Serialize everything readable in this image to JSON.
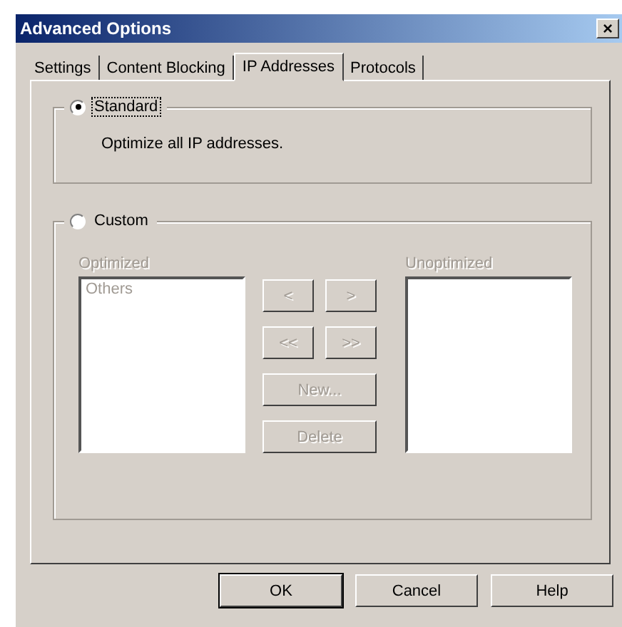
{
  "window": {
    "title": "Advanced Options",
    "close": "×"
  },
  "tabs": [
    {
      "label": "Settings",
      "selected": false
    },
    {
      "label": "Content Blocking",
      "selected": false
    },
    {
      "label": "IP Addresses",
      "selected": true
    },
    {
      "label": "Protocols",
      "selected": false
    }
  ],
  "standard": {
    "label": "Standard",
    "selected": true,
    "description": "Optimize all IP addresses."
  },
  "custom": {
    "label": "Custom",
    "selected": false,
    "optimized": {
      "label": "Optimized",
      "disabled": true,
      "items": [
        "Others"
      ]
    },
    "unoptimized": {
      "label": "Unoptimized",
      "disabled": true
    },
    "move_buttons": [
      {
        "label": "<",
        "disabled": true
      },
      {
        "label": ">",
        "disabled": true
      },
      {
        "label": "<<",
        "disabled": true
      },
      {
        "label": ">>",
        "disabled": true
      }
    ],
    "action_buttons": [
      {
        "label": "New...",
        "disabled": true
      },
      {
        "label": "Delete",
        "disabled": true
      }
    ]
  },
  "buttons": [
    {
      "label": "OK",
      "default": true
    },
    {
      "label": "Cancel",
      "default": false
    },
    {
      "label": "Help",
      "default": false
    }
  ]
}
